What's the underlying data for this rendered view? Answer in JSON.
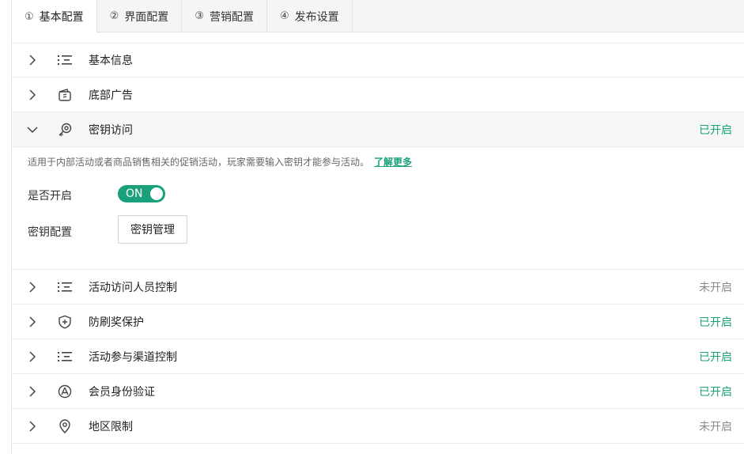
{
  "tabs": [
    {
      "num": "①",
      "label": "基本配置"
    },
    {
      "num": "②",
      "label": "界面配置"
    },
    {
      "num": "③",
      "label": "营销配置"
    },
    {
      "num": "④",
      "label": "发布设置"
    }
  ],
  "rows": {
    "basic_info": {
      "label": "基本信息",
      "icon": "list-icon"
    },
    "bottom_ad": {
      "label": "底部广告",
      "icon": "ad-card-icon"
    },
    "key_access": {
      "label": "密钥访问",
      "icon": "key-search-icon",
      "status": "已开启"
    },
    "visitor_control": {
      "label": "活动访问人员控制",
      "icon": "list-icon",
      "status": "未开启"
    },
    "anti_fraud": {
      "label": "防刷奖保护",
      "icon": "shield-plus-icon",
      "status": "已开启"
    },
    "channel_control": {
      "label": "活动参与渠道控制",
      "icon": "list-icon",
      "status": "已开启"
    },
    "member_verify": {
      "label": "会员身份验证",
      "icon": "user-verify-icon",
      "status": "已开启"
    },
    "region_limit": {
      "label": "地区限制",
      "icon": "location-pin-icon",
      "status": "未开启"
    }
  },
  "key_panel": {
    "description": "适用于内部活动或者商品销售相关的促销活动，玩家需要输入密钥才能参与活动。",
    "learn_more": "了解更多",
    "enable_label": "是否开启",
    "toggle_text": "ON",
    "config_label": "密钥配置",
    "manage_button": "密钥管理"
  },
  "colors": {
    "accent": "#1aa07a",
    "off_status": "#8a8a8a"
  }
}
